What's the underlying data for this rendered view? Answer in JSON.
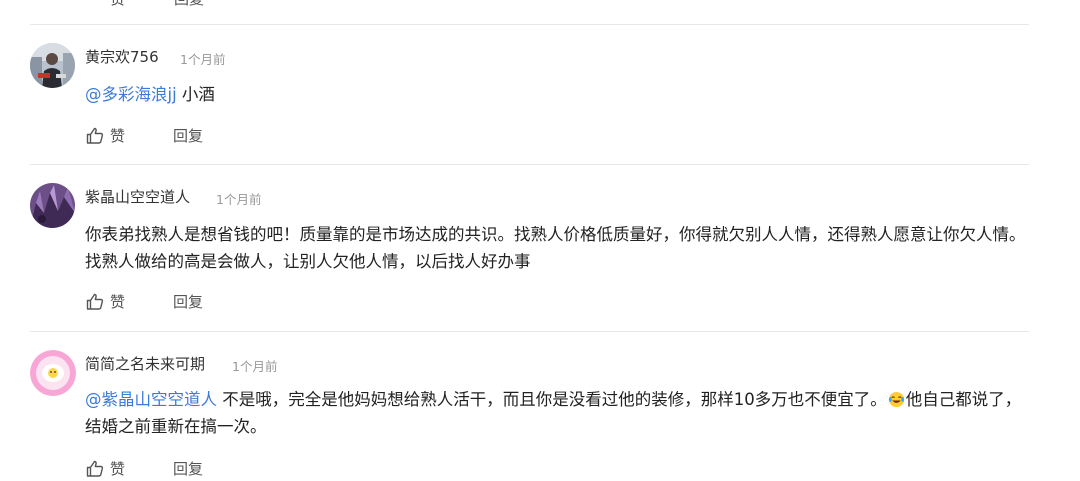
{
  "top_actions": {
    "like_label": "赞",
    "reply_label": "回复"
  },
  "comments": [
    {
      "username": "黄宗欢756",
      "time": "1个月前",
      "mention": "@多彩海浪jj",
      "text": " 小酒",
      "text_after_emoji": "",
      "like_label": "赞",
      "reply_label": "回复",
      "avatar_icon": "person-photo-avatar"
    },
    {
      "username": "紫晶山空空道人",
      "time": "1个月前",
      "mention": "",
      "text": "你表弟找熟人是想省钱的吧！质量靠的是市场达成的共识。找熟人价格低质量好，你得就欠别人人情，还得熟人愿意让你欠人情。找熟人做给的高是会做人，让别人欠他人情，以后找人好办事",
      "text_after_emoji": "",
      "like_label": "赞",
      "reply_label": "回复",
      "avatar_icon": "amethyst-avatar"
    },
    {
      "username": "简简之名未来可期",
      "time": "1个月前",
      "mention": "@紫晶山空空道人",
      "text": " 不是哦，完全是他妈妈想给熟人活干，而且你是没看过他的装修，那样10多万也不便宜了。",
      "text_after_emoji": "他自己都说了，结婚之前重新在搞一次。",
      "like_label": "赞",
      "reply_label": "回复",
      "avatar_icon": "cartoon-avatar",
      "emoji_icon": "laughing-tears-emoji"
    }
  ],
  "colors": {
    "mention": "#3c7bd6",
    "divider": "#e8e8e8",
    "time": "#999999"
  }
}
